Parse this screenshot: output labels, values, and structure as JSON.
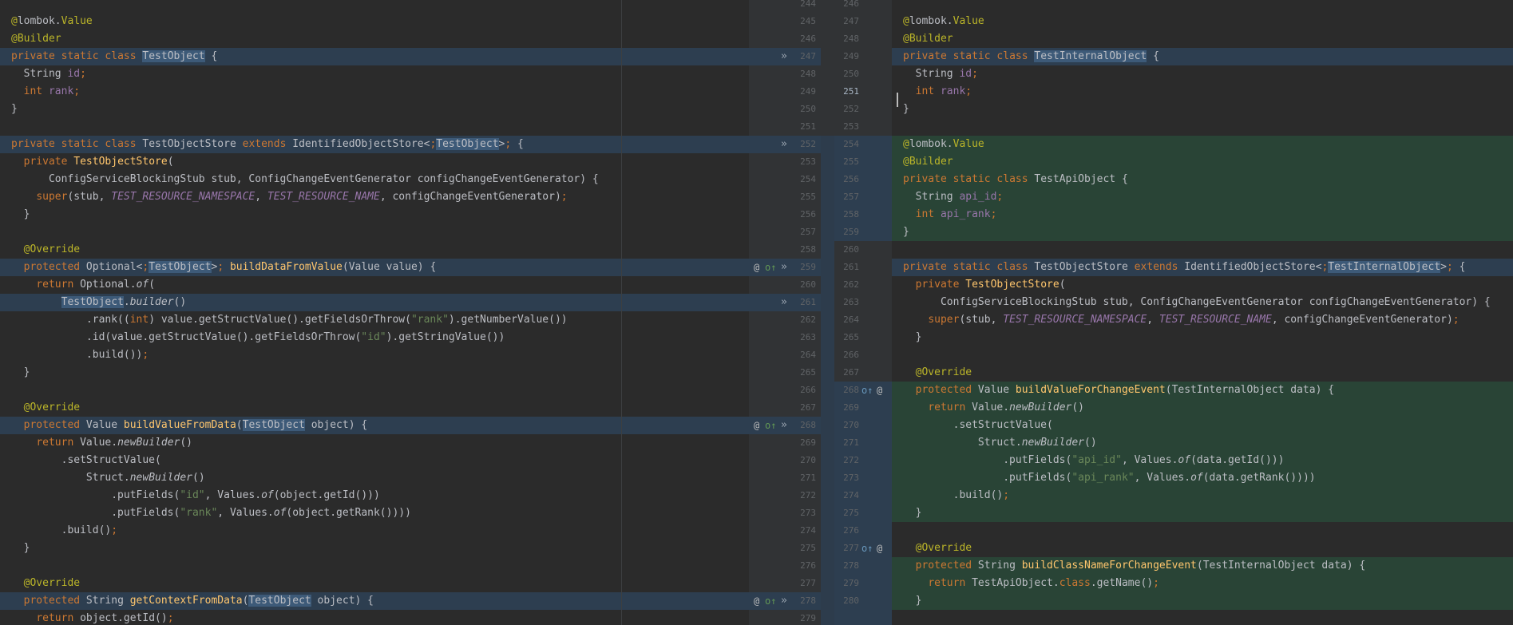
{
  "left_lines": [
    "",
    "@lombok.Value",
    "@Builder",
    "private static class TestObject {",
    "  String id;",
    "  int rank;",
    "}",
    "",
    "private static class TestObjectStore extends IdentifiedObjectStore<TestObject> {",
    "  private TestObjectStore(",
    "      ConfigServiceBlockingStub stub, ConfigChangeEventGenerator configChangeEventGenerator) {",
    "    super(stub, TEST_RESOURCE_NAMESPACE, TEST_RESOURCE_NAME, configChangeEventGenerator);",
    "  }",
    "",
    "  @Override",
    "  protected Optional<TestObject> buildDataFromValue(Value value) {",
    "    return Optional.of(",
    "        TestObject.builder()",
    "            .rank((int) value.getStructValue().getFieldsOrThrow(\"rank\").getNumberValue())",
    "            .id(value.getStructValue().getFieldsOrThrow(\"id\").getStringValue())",
    "            .build());",
    "  }",
    "",
    "  @Override",
    "  protected Value buildValueFromData(TestObject object) {",
    "    return Value.newBuilder()",
    "        .setStructValue(",
    "            Struct.newBuilder()",
    "                .putFields(\"id\", Values.of(object.getId()))",
    "                .putFields(\"rank\", Values.of(object.getRank())))",
    "        .build();",
    "  }",
    "",
    "  @Override",
    "  protected String getContextFromData(TestObject object) {",
    "    return object.getId();"
  ],
  "right_lines": [
    "",
    "@lombok.Value",
    "@Builder",
    "private static class TestInternalObject {",
    "  String id;",
    "  int rank;",
    "}",
    "",
    "@lombok.Value",
    "@Builder",
    "private static class TestApiObject {",
    "  String api_id;",
    "  int api_rank;",
    "}",
    "",
    "private static class TestObjectStore extends IdentifiedObjectStore<TestInternalObject> {",
    "  private TestObjectStore(",
    "      ConfigServiceBlockingStub stub, ConfigChangeEventGenerator configChangeEventGenerator) {",
    "    super(stub, TEST_RESOURCE_NAMESPACE, TEST_RESOURCE_NAME, configChangeEventGenerator);",
    "  }",
    "",
    "  @Override",
    "  protected Value buildValueForChangeEvent(TestInternalObject data) {",
    "    return Value.newBuilder()",
    "        .setStructValue(",
    "            Struct.newBuilder()",
    "                .putFields(\"api_id\", Values.of(data.getId()))",
    "                .putFields(\"api_rank\", Values.of(data.getRank())))",
    "        .build();",
    "  }",
    "",
    "  @Override",
    "  protected String buildClassNameForChangeEvent(TestInternalObject data) {",
    "    return TestApiObject.class.getName();",
    "  }"
  ],
  "left_line_numbers": [
    "244",
    "245",
    "246",
    "247",
    "248",
    "249",
    "250",
    "251",
    "252",
    "253",
    "254",
    "255",
    "256",
    "257",
    "258",
    "259",
    "260",
    "261",
    "262",
    "263",
    "264",
    "265",
    "266",
    "267",
    "268",
    "269",
    "270",
    "271",
    "272",
    "273",
    "274",
    "275",
    "276",
    "277",
    "278",
    "279"
  ],
  "right_line_numbers": [
    "246",
    "247",
    "248",
    "249",
    "250",
    "251",
    "252",
    "253",
    "254",
    "255",
    "256",
    "257",
    "258",
    "259",
    "260",
    "261",
    "262",
    "263",
    "264",
    "265",
    "266",
    "267",
    "268",
    "269",
    "270",
    "271",
    "272",
    "273",
    "274",
    "275",
    "276",
    "277",
    "278",
    "279",
    "280"
  ],
  "current_line_number": "251",
  "gutter_icons": {
    "apply": "»",
    "override_marker": "@",
    "implementation_marker": "o↑"
  },
  "colors": {
    "modified": "#2d3e50",
    "added": "#294436",
    "keyword": "#cc7832",
    "string": "#6a8759",
    "annotation": "#bbb529",
    "function": "#ffc66d",
    "field": "#9876aa"
  }
}
